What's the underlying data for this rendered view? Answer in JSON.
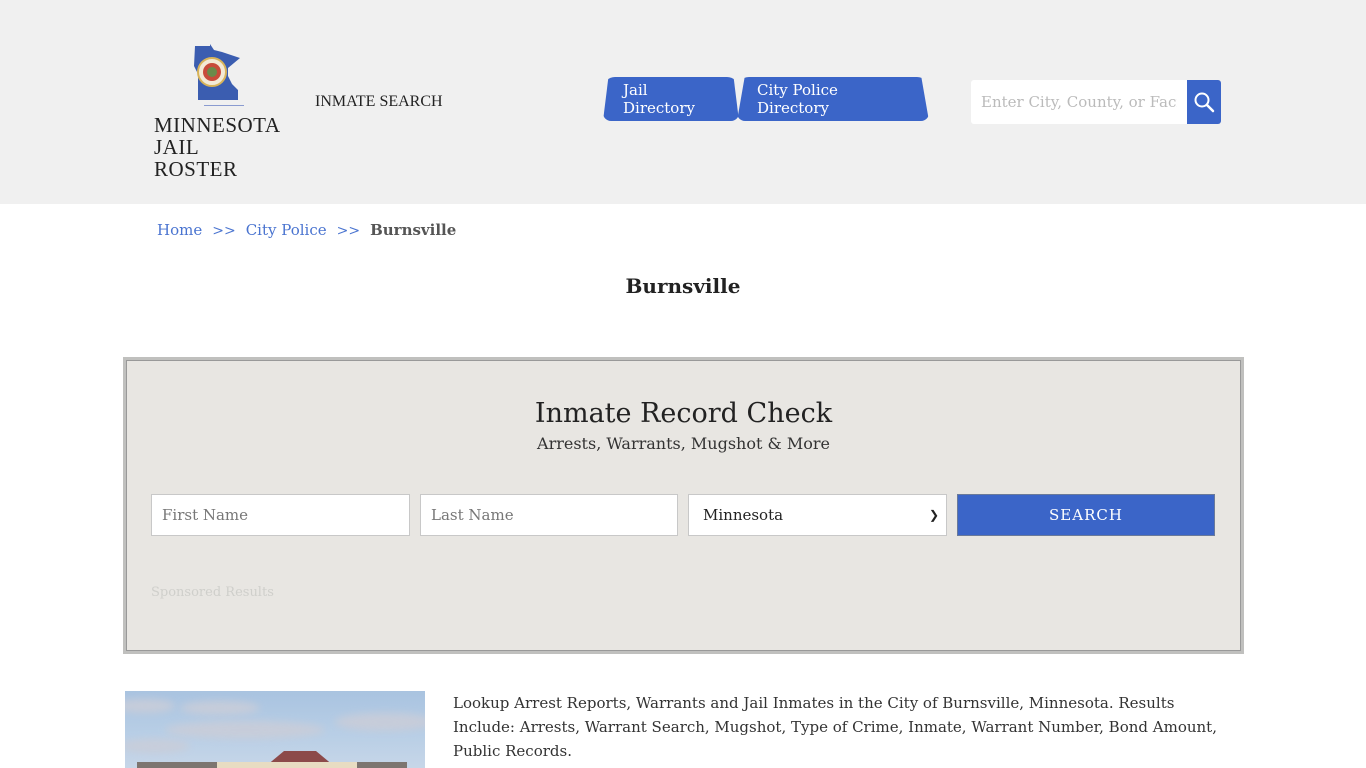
{
  "header": {
    "logo": {
      "line1": "MINNESOTA",
      "line2": "JAIL ROSTER",
      "icon": "minnesota-state-seal-icon"
    },
    "inmate_search_link": "INMATE SEARCH",
    "nav": [
      {
        "label": "Jail Directory"
      },
      {
        "label": "City Police Directory"
      }
    ],
    "search": {
      "placeholder": "Enter City, County, or Facility",
      "icon": "search-icon"
    }
  },
  "breadcrumb": {
    "items": [
      {
        "label": "Home"
      },
      {
        "label": "City Police"
      },
      {
        "label": "Burnsville"
      }
    ],
    "separator": ">>"
  },
  "page_title": "Burnsville",
  "record_check": {
    "title": "Inmate Record Check",
    "subtitle": "Arrests, Warrants, Mugshot & More",
    "first_name_placeholder": "First Name",
    "last_name_placeholder": "Last Name",
    "state_selected": "Minnesota",
    "search_label": "SEARCH",
    "sponsored": "Sponsored Results"
  },
  "description": "Lookup Arrest Reports, Warrants and Jail Inmates in the City of Burnsville, Minnesota. Results Include: Arrests, Warrant Search, Mugshot, Type of Crime, Inmate, Warrant Number, Bond Amount, Public Records.",
  "colors": {
    "accent": "#3b65c8",
    "header_bg": "#f0f0f0",
    "panel_bg": "#e8e6e2"
  }
}
